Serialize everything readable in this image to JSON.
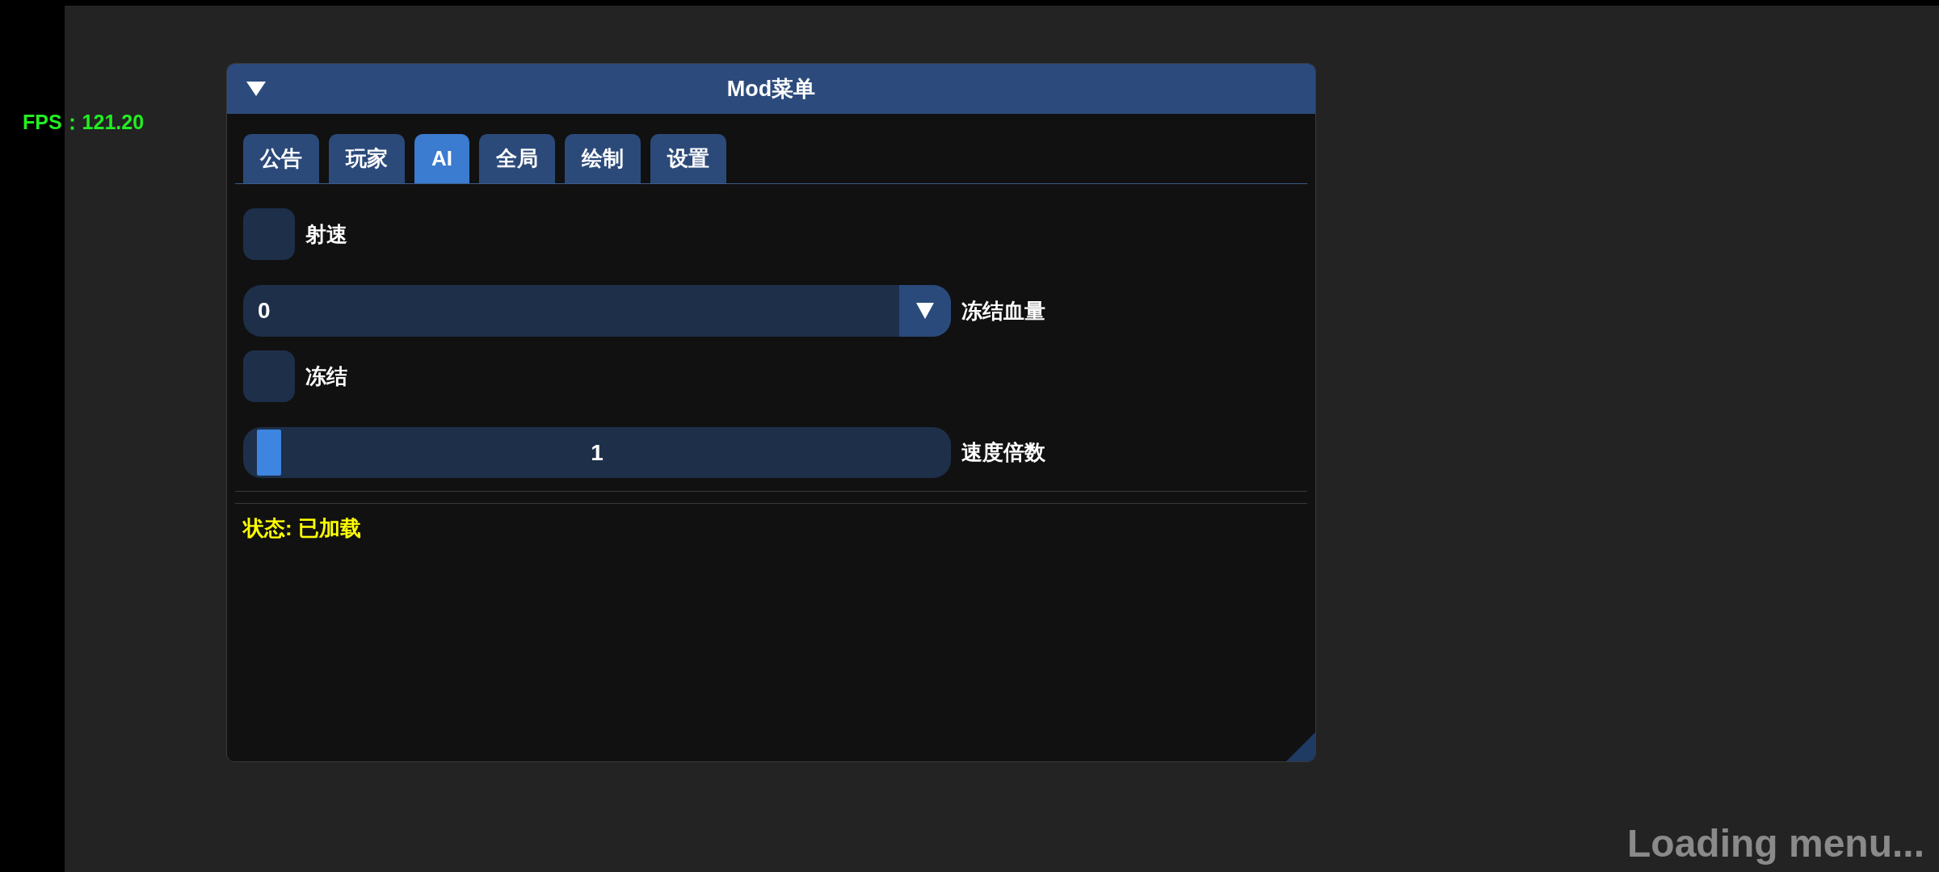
{
  "fps_overlay": {
    "text": "FPS：121.20"
  },
  "window": {
    "title": "Mod菜单",
    "tabs": [
      {
        "label": "公告",
        "selected": false
      },
      {
        "label": "玩家",
        "selected": false
      },
      {
        "label": "AI",
        "selected": true
      },
      {
        "label": "全局",
        "selected": false
      },
      {
        "label": "绘制",
        "selected": false
      },
      {
        "label": "设置",
        "selected": false
      }
    ],
    "controls": [
      {
        "kind": "checkbox",
        "label": "射速",
        "checked": false
      },
      {
        "kind": "combo",
        "value": "0",
        "label": "冻结血量"
      },
      {
        "kind": "checkbox",
        "label": "冻结",
        "checked": false
      },
      {
        "kind": "slider",
        "value": "1",
        "level": 0,
        "label": "速度倍数"
      }
    ],
    "status": "状态: 已加载"
  },
  "loading_text": "Loading menu..."
}
